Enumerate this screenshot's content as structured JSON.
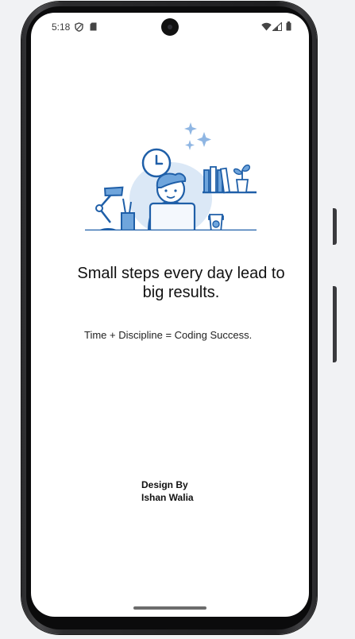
{
  "status_bar": {
    "time": "5:18",
    "icons": [
      "shield-icon",
      "sim-card-icon",
      "wifi-icon",
      "signal-icon",
      "battery-icon"
    ]
  },
  "illustration": {
    "name": "person-at-desk-illustration",
    "colors": {
      "primary": "#1f5fa8",
      "light": "#6fa5dc",
      "pale": "#dbe8f6"
    }
  },
  "content": {
    "quote": "Small steps every day lead to big results.",
    "subtitle": "Time + Discipline = Coding Success.",
    "credit_line1": "Design By",
    "credit_line2": "Ishan Walia"
  }
}
